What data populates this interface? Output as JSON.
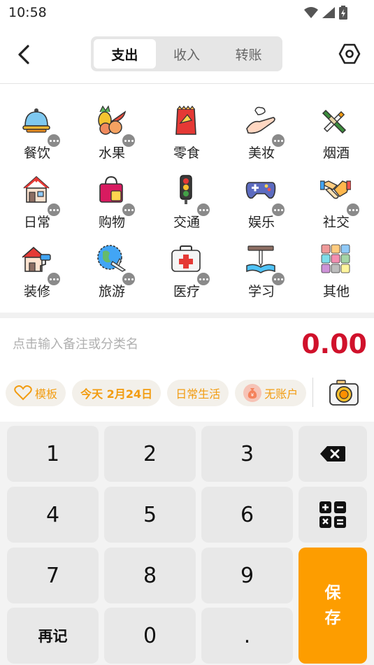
{
  "status_bar": {
    "time": "10:58"
  },
  "header": {
    "tabs": [
      {
        "label": "支出",
        "active": true
      },
      {
        "label": "收入",
        "active": false
      },
      {
        "label": "转账",
        "active": false
      }
    ]
  },
  "categories": [
    {
      "label": "餐饮",
      "icon": "dining-cloche-icon"
    },
    {
      "label": "水果",
      "icon": "fruit-icon"
    },
    {
      "label": "零食",
      "icon": "snack-bag-icon"
    },
    {
      "label": "美妆",
      "icon": "cosmetics-hand-icon"
    },
    {
      "label": "烟酒",
      "icon": "cigarette-wine-icon"
    },
    {
      "label": "日常",
      "icon": "house-icon"
    },
    {
      "label": "购物",
      "icon": "shopping-bag-icon"
    },
    {
      "label": "交通",
      "icon": "traffic-light-icon"
    },
    {
      "label": "娱乐",
      "icon": "gamepad-icon"
    },
    {
      "label": "社交",
      "icon": "handshake-icon"
    },
    {
      "label": "装修",
      "icon": "paint-roller-house-icon"
    },
    {
      "label": "旅游",
      "icon": "globe-plane-icon"
    },
    {
      "label": "医疗",
      "icon": "first-aid-kit-icon"
    },
    {
      "label": "学习",
      "icon": "book-pen-icon"
    },
    {
      "label": "其他",
      "icon": "color-grid-icon"
    }
  ],
  "entry": {
    "note_placeholder": "点击输入备注或分类名",
    "amount": "0.00"
  },
  "chips": {
    "template": "模板",
    "date": "今天 2月24日",
    "book": "日常生活",
    "account": "无账户"
  },
  "keypad": {
    "keys": [
      "1",
      "2",
      "3",
      "4",
      "5",
      "6",
      "7",
      "8",
      "9",
      "再记",
      "0",
      "."
    ],
    "save_top": "保",
    "save_bottom": "存"
  },
  "colors": {
    "accent": "#fd9d00",
    "amount": "#d0112b",
    "chip_text": "#f29c11"
  }
}
